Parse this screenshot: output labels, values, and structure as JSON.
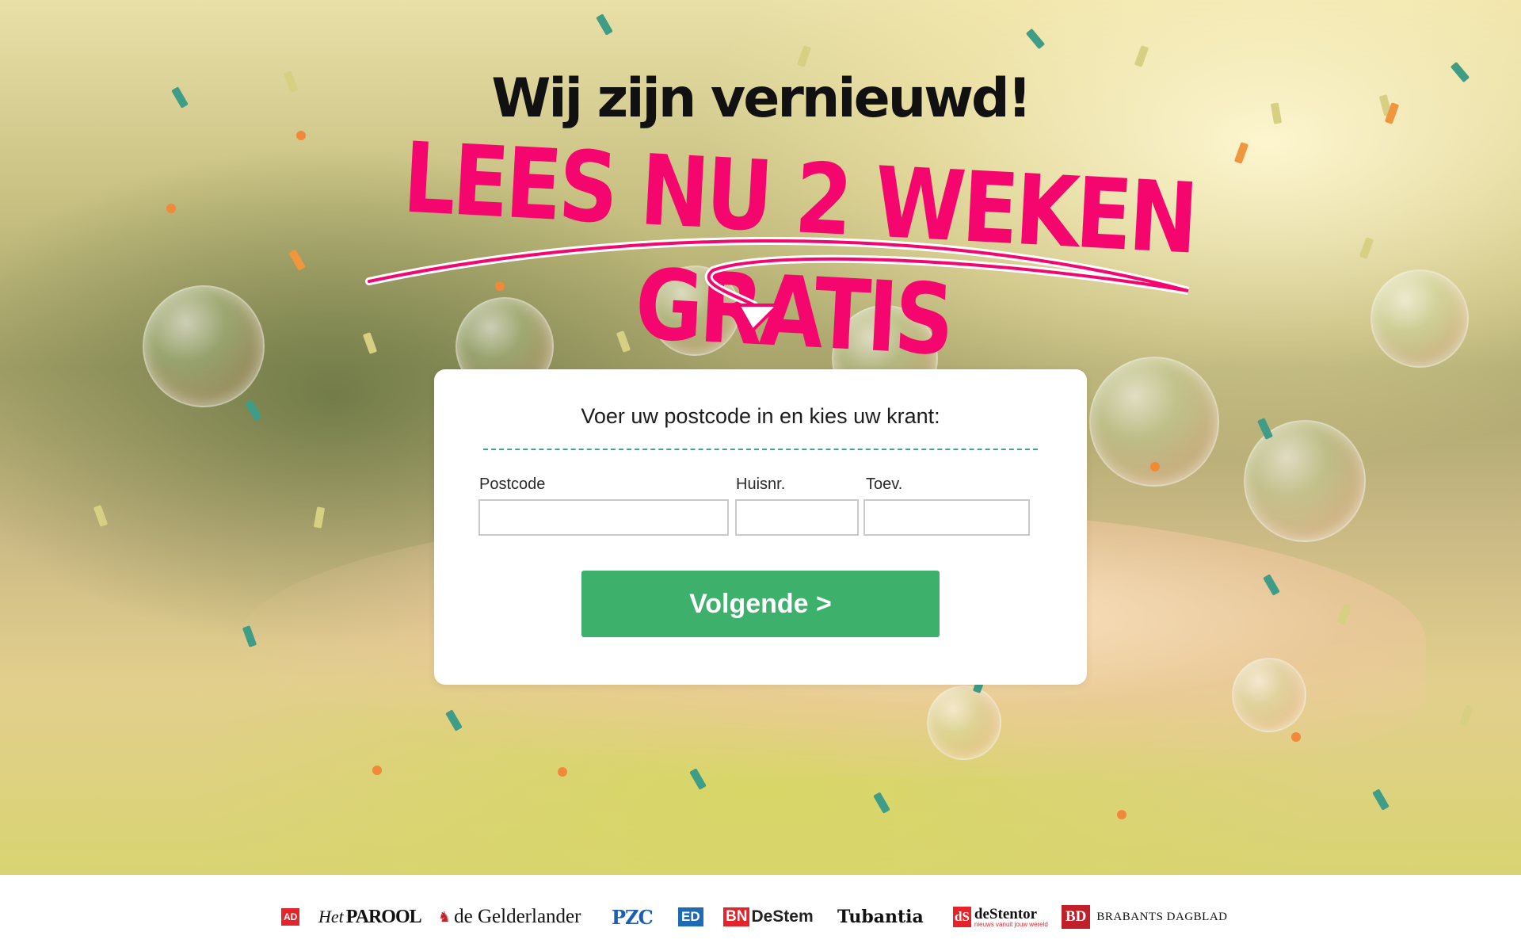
{
  "hero": {
    "headline": "Wij zijn vernieuwd!",
    "promo": "LEES NU 2 WEKEN GRATIS",
    "accent_color": "#f5066f"
  },
  "form": {
    "title": "Voer uw postcode in en kies uw krant:",
    "postcode_label": "Postcode",
    "postcode_value": "",
    "huisnr_label": "Huisnr.",
    "huisnr_value": "",
    "toev_label": "Toev.",
    "toev_value": "",
    "next_label": "Volgende >",
    "button_color": "#3db06b"
  },
  "brands": {
    "ad": "AD",
    "parool_prefix": "Het",
    "parool": "PAROOL",
    "gelderlander": "de Gelderlander",
    "pzc": "PZC",
    "ed": "ED",
    "bn": "BN",
    "destem": "DeStem",
    "tubantia": "Tubantia",
    "stentor_mark": "dS",
    "stentor": "deStentor",
    "stentor_tagline": "nieuws vanuit jouw wereld",
    "bd_mark": "BD",
    "brabants": "BRABANTS DAGBLAD"
  }
}
